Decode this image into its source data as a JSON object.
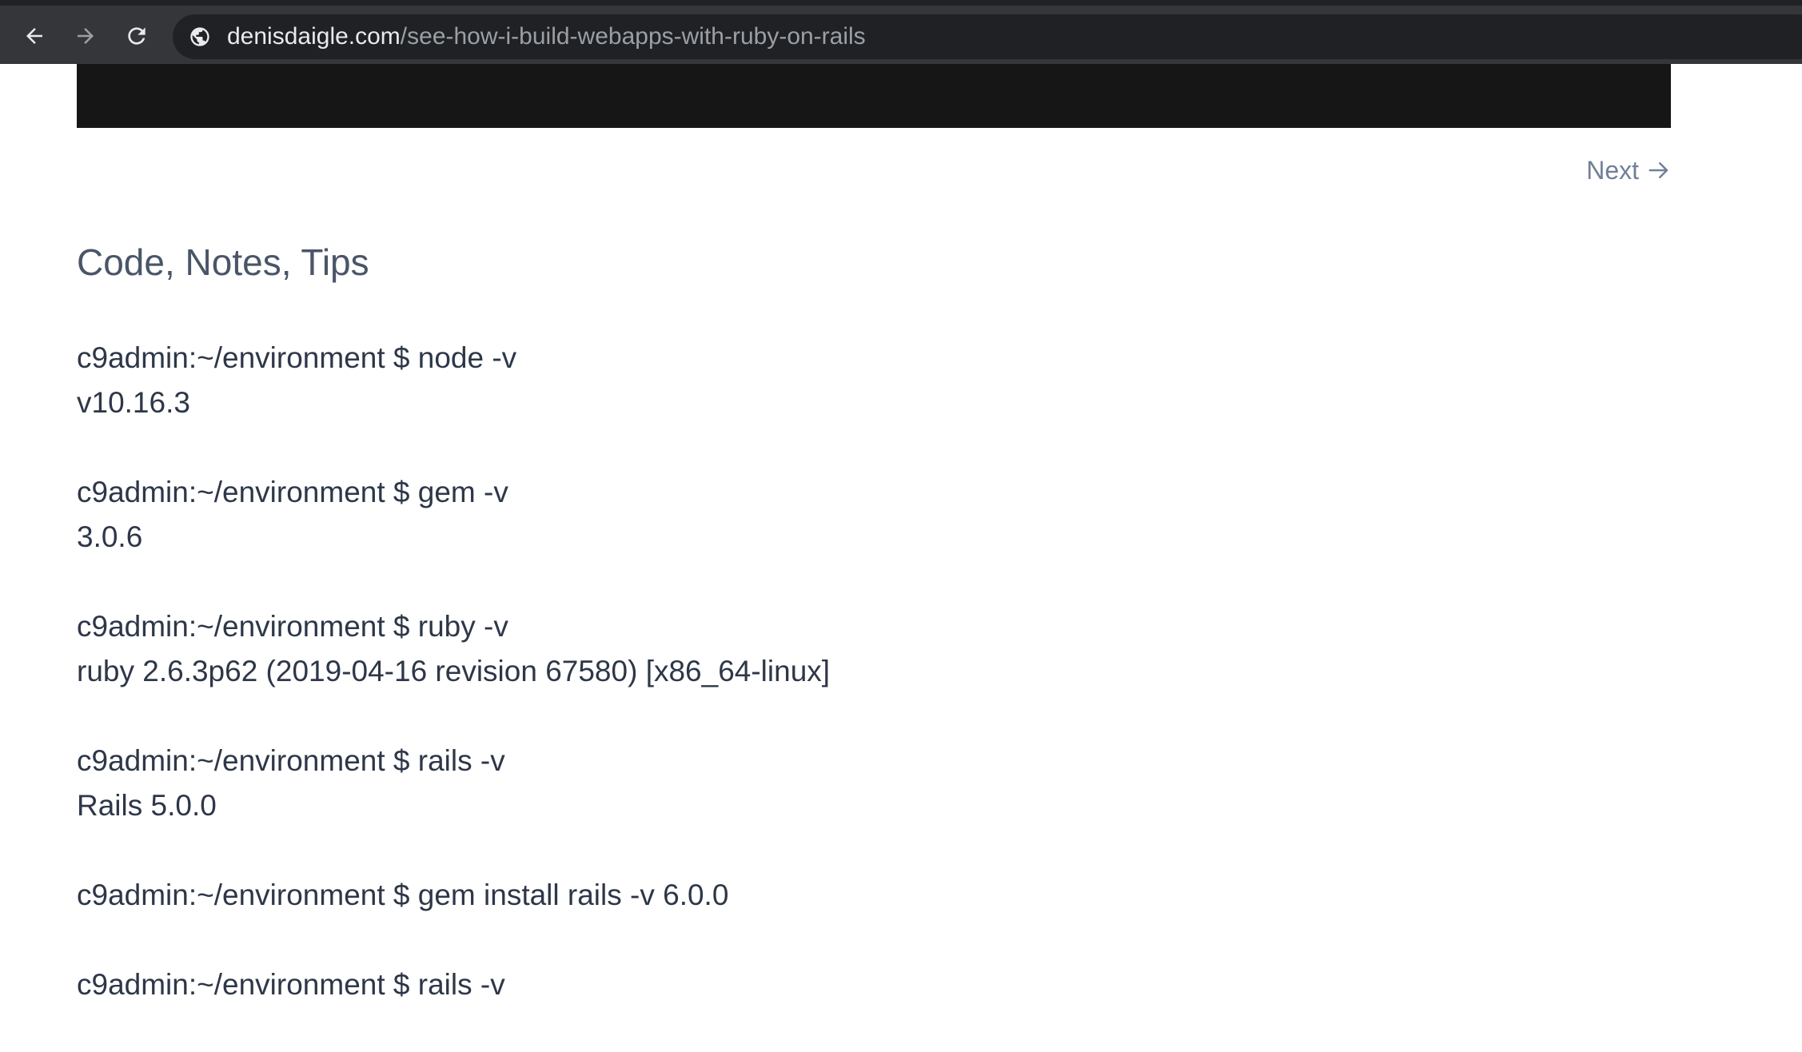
{
  "browser": {
    "url_domain": "denisdaigle.com",
    "url_path": "/see-how-i-build-webapps-with-ruby-on-rails",
    "icons": [
      "back-arrow-icon",
      "forward-arrow-icon",
      "reload-icon",
      "site-info-icon"
    ]
  },
  "content": {
    "next_label": "Next",
    "section_title": "Code, Notes, Tips",
    "blocks": [
      {
        "command": "c9admin:~/environment $ node -v",
        "output": "v10.16.3"
      },
      {
        "command": "c9admin:~/environment $ gem -v",
        "output": "3.0.6"
      },
      {
        "command": "c9admin:~/environment $ ruby -v",
        "output": "ruby 2.6.3p62 (2019-04-16 revision 67580) [x86_64-linux]"
      },
      {
        "command": "c9admin:~/environment $ rails -v",
        "output": "Rails 5.0.0"
      },
      {
        "command": "c9admin:~/environment $ gem install rails -v 6.0.0"
      },
      {
        "command": "c9admin:~/environment $ rails -v"
      }
    ]
  },
  "colors": {
    "toolbar_bg": "#35363a",
    "omnibox_bg": "#202124",
    "video_band": "#161616",
    "title_color": "#4a5568",
    "text_color": "#2d3748",
    "link_color": "#718096"
  }
}
